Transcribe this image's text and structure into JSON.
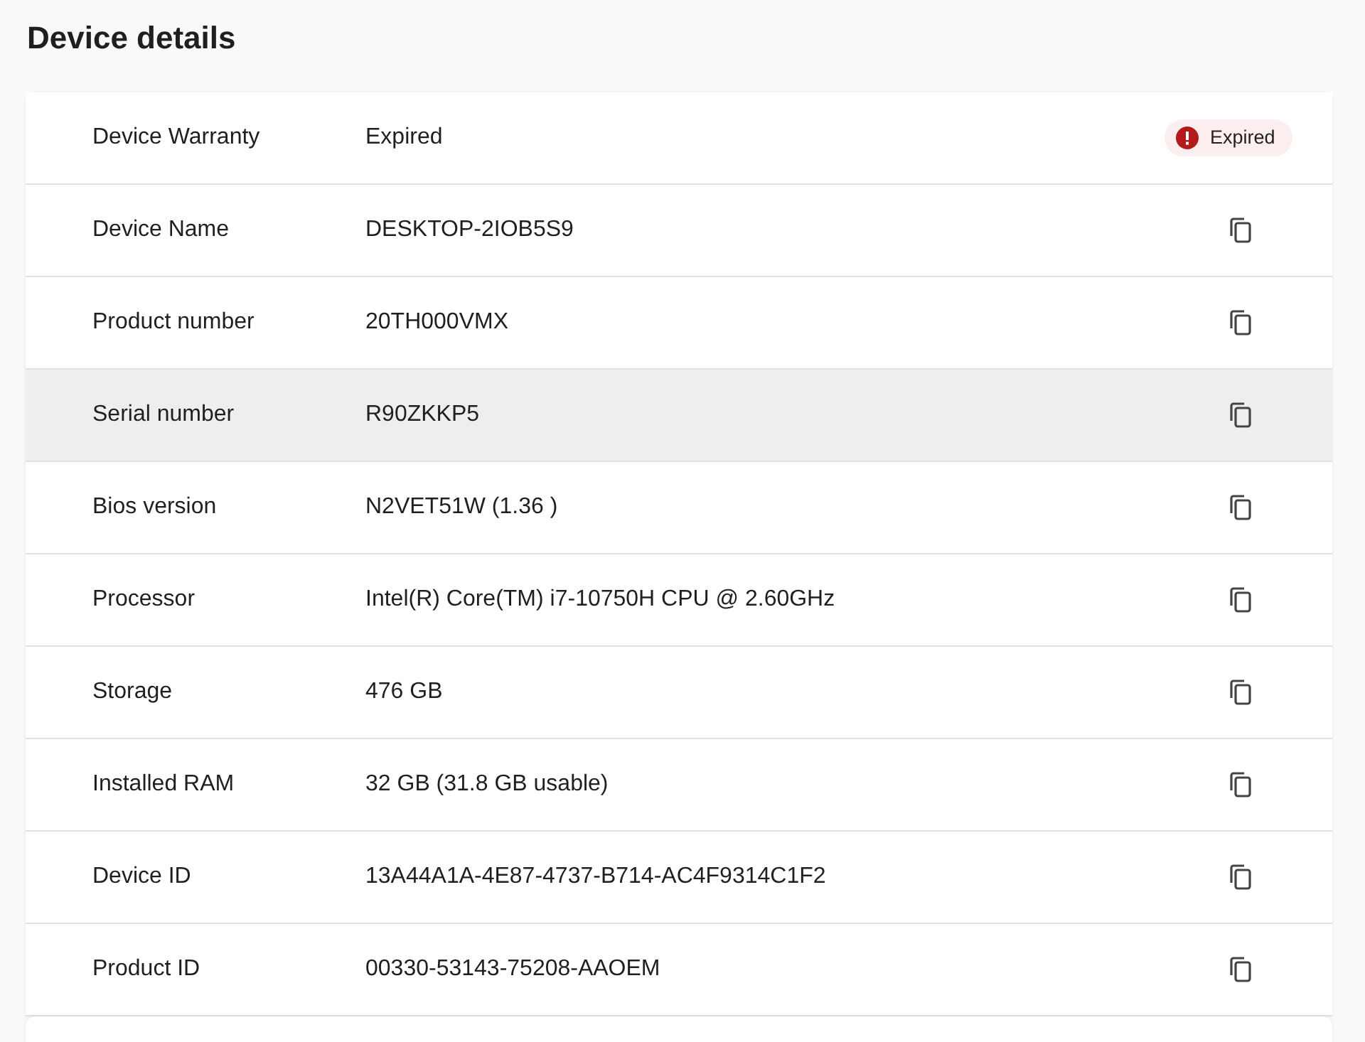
{
  "title": "Device details",
  "rows": [
    {
      "kind": "badge",
      "label": "Device Warranty",
      "value": "Expired",
      "badge": "Expired",
      "selected": false
    },
    {
      "kind": "copy",
      "label": "Device Name",
      "value": "DESKTOP-2IOB5S9",
      "selected": false
    },
    {
      "kind": "copy",
      "label": "Product number",
      "value": "20TH000VMX",
      "selected": false
    },
    {
      "kind": "copy",
      "label": "Serial number",
      "value": "R90ZKKP5",
      "selected": true
    },
    {
      "kind": "copy",
      "label": "Bios version",
      "value": "N2VET51W (1.36 )",
      "selected": false
    },
    {
      "kind": "copy",
      "label": "Processor",
      "value": "Intel(R) Core(TM) i7-10750H CPU @ 2.60GHz",
      "selected": false
    },
    {
      "kind": "copy",
      "label": "Storage",
      "value": "476 GB",
      "selected": false
    },
    {
      "kind": "copy",
      "label": "Installed RAM",
      "value": "32 GB (31.8 GB usable)",
      "selected": false
    },
    {
      "kind": "copy",
      "label": "Device ID",
      "value": "13A44A1A-4E87-4737-B714-AC4F9314C1F2",
      "selected": false
    },
    {
      "kind": "copy",
      "label": "Product ID",
      "value": "00330-53143-75208-AAOEM",
      "selected": false
    }
  ]
}
